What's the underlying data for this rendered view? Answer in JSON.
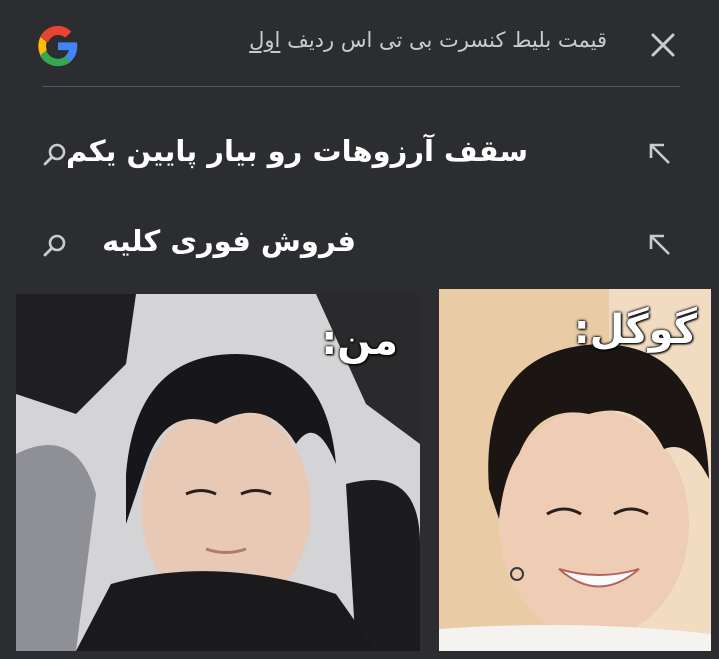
{
  "search": {
    "query_main": "قیمت بلیط کنسرت بی تی اس ردیف",
    "query_underlined": "اول"
  },
  "suggestions": [
    {
      "text": "سقف آرزوهات رو بیار پایین یکم"
    },
    {
      "text": "فروش فوری کلیه"
    }
  ],
  "meme": {
    "left_caption": "من:",
    "right_caption": "گوگل:"
  },
  "colors": {
    "background": "#2b2d30",
    "query_text": "#c9cbcf",
    "suggestion_text": "#ffffff"
  },
  "icons": [
    "google-logo-icon",
    "close-icon",
    "search-icon",
    "arrow-up-left-icon"
  ]
}
